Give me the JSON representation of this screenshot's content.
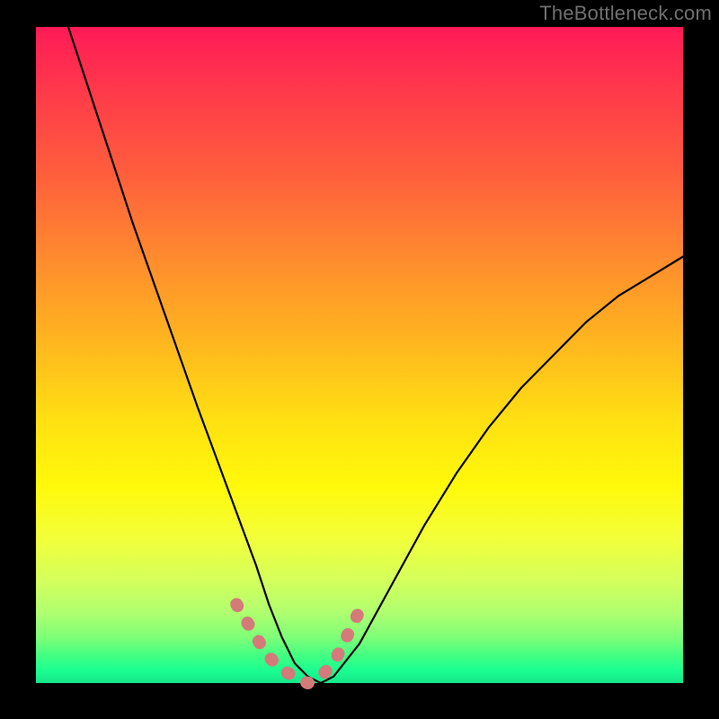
{
  "watermark": "TheBottleneck.com",
  "chart_data": {
    "type": "line",
    "title": "",
    "xlabel": "",
    "ylabel": "",
    "xlim": [
      0,
      100
    ],
    "ylim": [
      0,
      100
    ],
    "grid": false,
    "legend": false,
    "series": [
      {
        "name": "black-curve",
        "color": "#000000",
        "x": [
          5,
          10,
          15,
          20,
          25,
          28,
          31,
          34,
          36,
          38,
          40,
          42,
          44,
          46,
          50,
          55,
          60,
          65,
          70,
          75,
          80,
          85,
          90,
          95,
          100
        ],
        "y": [
          100,
          85,
          70,
          56,
          42,
          34,
          26,
          18,
          12,
          7,
          3,
          1,
          0,
          1,
          6,
          15,
          24,
          32,
          39,
          45,
          50,
          55,
          59,
          62,
          65
        ]
      },
      {
        "name": "pink-highlight",
        "color": "#d97f7f",
        "x": [
          31,
          34,
          36,
          38,
          40,
          42,
          44,
          46,
          48,
          50
        ],
        "y": [
          12,
          7,
          4,
          2,
          1,
          0,
          1,
          3,
          7,
          11
        ]
      }
    ],
    "background_gradient": {
      "direction": "vertical",
      "stops": [
        {
          "pos": 0.0,
          "color": "#ff1a57"
        },
        {
          "pos": 0.35,
          "color": "#ff8a2e"
        },
        {
          "pos": 0.7,
          "color": "#fff90a"
        },
        {
          "pos": 1.0,
          "color": "#17e78a"
        }
      ]
    }
  }
}
